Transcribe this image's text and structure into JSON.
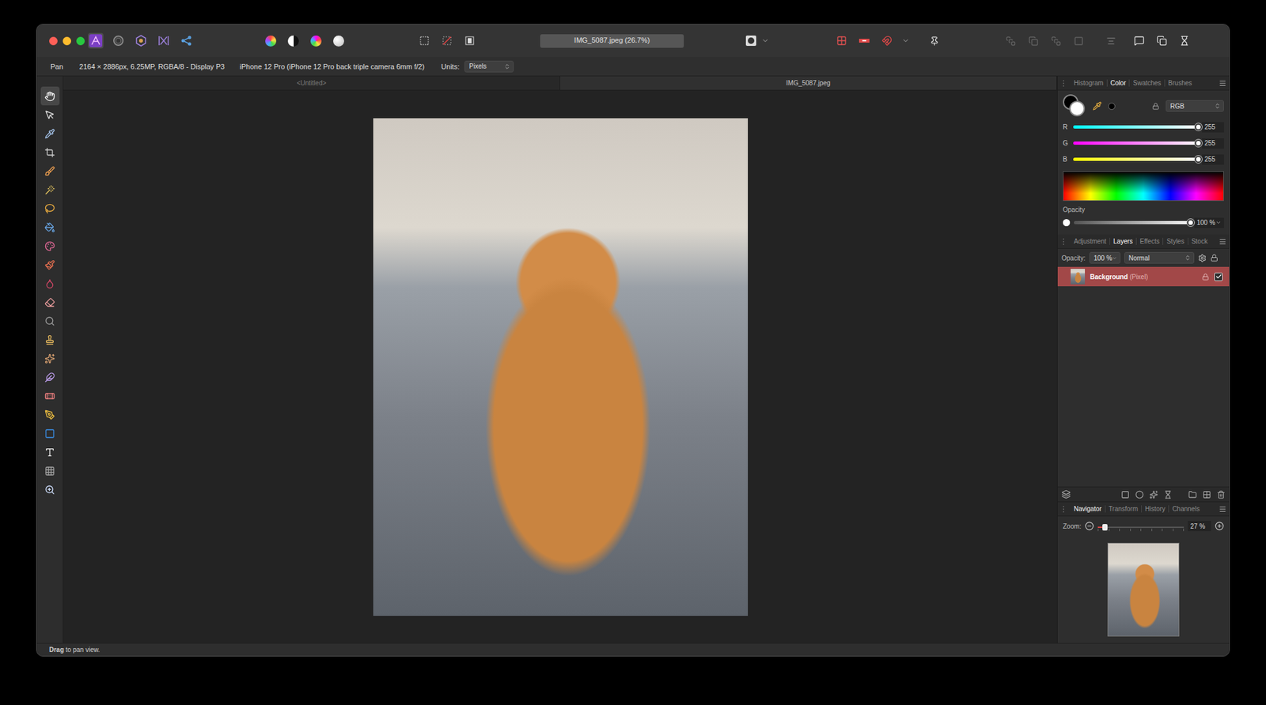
{
  "window": {
    "title": "IMG_5087.jpeg (26.7%)"
  },
  "personas": [
    {
      "selected": true
    },
    {
      "selected": false
    },
    {
      "selected": false
    },
    {
      "selected": false
    },
    {
      "selected": false
    }
  ],
  "context_bar": {
    "tool": "Pan",
    "document_info": "2164 × 2886px, 6.25MP, RGBA/8 - Display P3",
    "camera": "iPhone 12 Pro (iPhone 12 Pro back triple camera 6mm f/2)",
    "units_label": "Units:",
    "units_value": "Pixels"
  },
  "document_tabs": [
    {
      "label": "<Untitled>",
      "selected": false
    },
    {
      "label": "IMG_5087.jpeg",
      "selected": true
    }
  ],
  "tools": [
    {
      "selected": true
    },
    {
      "selected": false
    },
    {
      "selected": false
    },
    {
      "selected": false
    },
    {
      "selected": false
    },
    {
      "selected": false
    },
    {
      "selected": false
    },
    {
      "selected": false
    },
    {
      "selected": false
    },
    {
      "selected": false
    },
    {
      "selected": false
    },
    {
      "selected": false
    },
    {
      "selected": false
    },
    {
      "selected": false
    },
    {
      "selected": false
    },
    {
      "selected": false
    },
    {
      "selected": false
    },
    {
      "selected": false
    },
    {
      "selected": false
    },
    {
      "selected": false
    },
    {
      "selected": false
    },
    {
      "selected": false
    }
  ],
  "color_panel": {
    "tabs": [
      {
        "label": "Histogram",
        "selected": false
      },
      {
        "label": "Color",
        "selected": true
      },
      {
        "label": "Swatches",
        "selected": false
      },
      {
        "label": "Brushes",
        "selected": false
      }
    ],
    "model": "RGB",
    "channels": [
      {
        "name": "R",
        "value": "255",
        "level": 1,
        "color": "#00ffff"
      },
      {
        "name": "G",
        "value": "255",
        "level": 1,
        "color": "#ff00ff"
      },
      {
        "name": "B",
        "value": "255",
        "level": 1,
        "color": "#ffff00"
      }
    ],
    "opacity": {
      "label": "Opacity",
      "value": "100 %",
      "level": 1
    }
  },
  "layers_panel": {
    "tabs": [
      {
        "label": "Adjustment",
        "selected": false
      },
      {
        "label": "Layers",
        "selected": true
      },
      {
        "label": "Effects",
        "selected": false
      },
      {
        "label": "Styles",
        "selected": false
      },
      {
        "label": "Stock",
        "selected": false
      }
    ],
    "opacity_label": "Opacity:",
    "opacity_value": "100 %",
    "blend_mode": "Normal",
    "layers": [
      {
        "name": "Background",
        "type": "(Pixel)",
        "selected": true,
        "locked": true,
        "visible": true
      }
    ]
  },
  "navigator_panel": {
    "tabs": [
      {
        "label": "Navigator",
        "selected": true
      },
      {
        "label": "Transform",
        "selected": false
      },
      {
        "label": "History",
        "selected": false
      },
      {
        "label": "Channels",
        "selected": false
      }
    ],
    "zoom_label": "Zoom:",
    "zoom_value": "27 %",
    "zoom_level": 0.08
  },
  "status_bar": {
    "action": "Drag",
    "hint": " to pan view."
  }
}
